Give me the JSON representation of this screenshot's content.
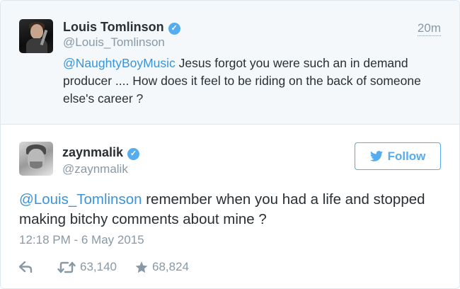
{
  "parent_tweet": {
    "name": "Louis Tomlinson",
    "handle": "@Louis_Tomlinson",
    "time": "20m",
    "mention": "@NaughtyBoyMusic",
    "text": " Jesus forgot you were such an in demand producer .... How does it feel to be riding on the back of someone else's career ?"
  },
  "tweet": {
    "name": "zaynmalik",
    "handle": "@zaynmalik",
    "follow_label": "Follow",
    "mention": "@Louis_Tomlinson",
    "text": " remember when you had a life and stopped making bitchy comments about mine ?",
    "timestamp": "12:18 PM - 6 May 2015",
    "retweets": "63,140",
    "favorites": "68,824"
  },
  "colors": {
    "accent": "#55acee",
    "link": "#3b94d9",
    "muted": "#8899a6",
    "text": "#292f33",
    "parent_bg": "#f5f8fa"
  },
  "icons": [
    "verified-badge-icon",
    "twitter-bird-icon",
    "reply-icon",
    "retweet-icon",
    "favorite-star-icon"
  ]
}
